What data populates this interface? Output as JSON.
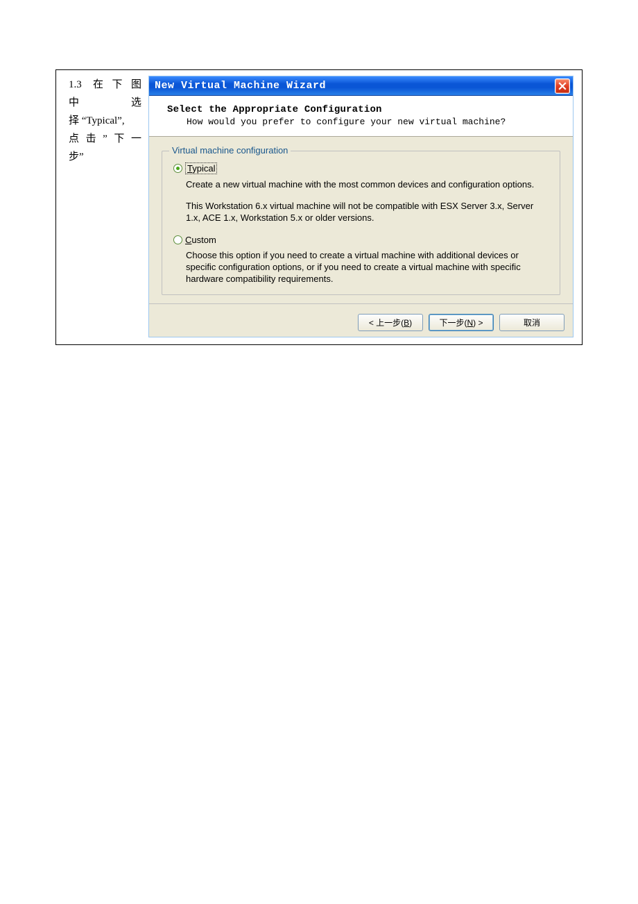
{
  "doc": {
    "left_text_lines": [
      "1.3 在下图",
      "中　　　　选",
      "择 “Typical”,",
      "点击”下一",
      "步”"
    ]
  },
  "wizard": {
    "title": "New Virtual Machine Wizard",
    "header": {
      "title": "Select the Appropriate Configuration",
      "subtitle": "How would you prefer to configure your new virtual machine?"
    },
    "group_legend": "Virtual machine configuration",
    "typical": {
      "label_prefix": "T",
      "label_rest": "ypical",
      "desc1": "Create a new virtual machine with the most common devices and configuration options.",
      "desc2": "This Workstation 6.x virtual machine will not be compatible with ESX Server 3.x, Server 1.x, ACE 1.x, Workstation 5.x or older versions."
    },
    "custom": {
      "label_prefix": "C",
      "label_rest": "ustom",
      "desc": "Choose this option if you need to create a virtual machine with additional devices or specific configuration options, or if you need to create a virtual machine with specific hardware compatibility requirements."
    },
    "buttons": {
      "back": "< 上一步(B)",
      "next": "下一步(N) >",
      "cancel": "取消"
    }
  }
}
